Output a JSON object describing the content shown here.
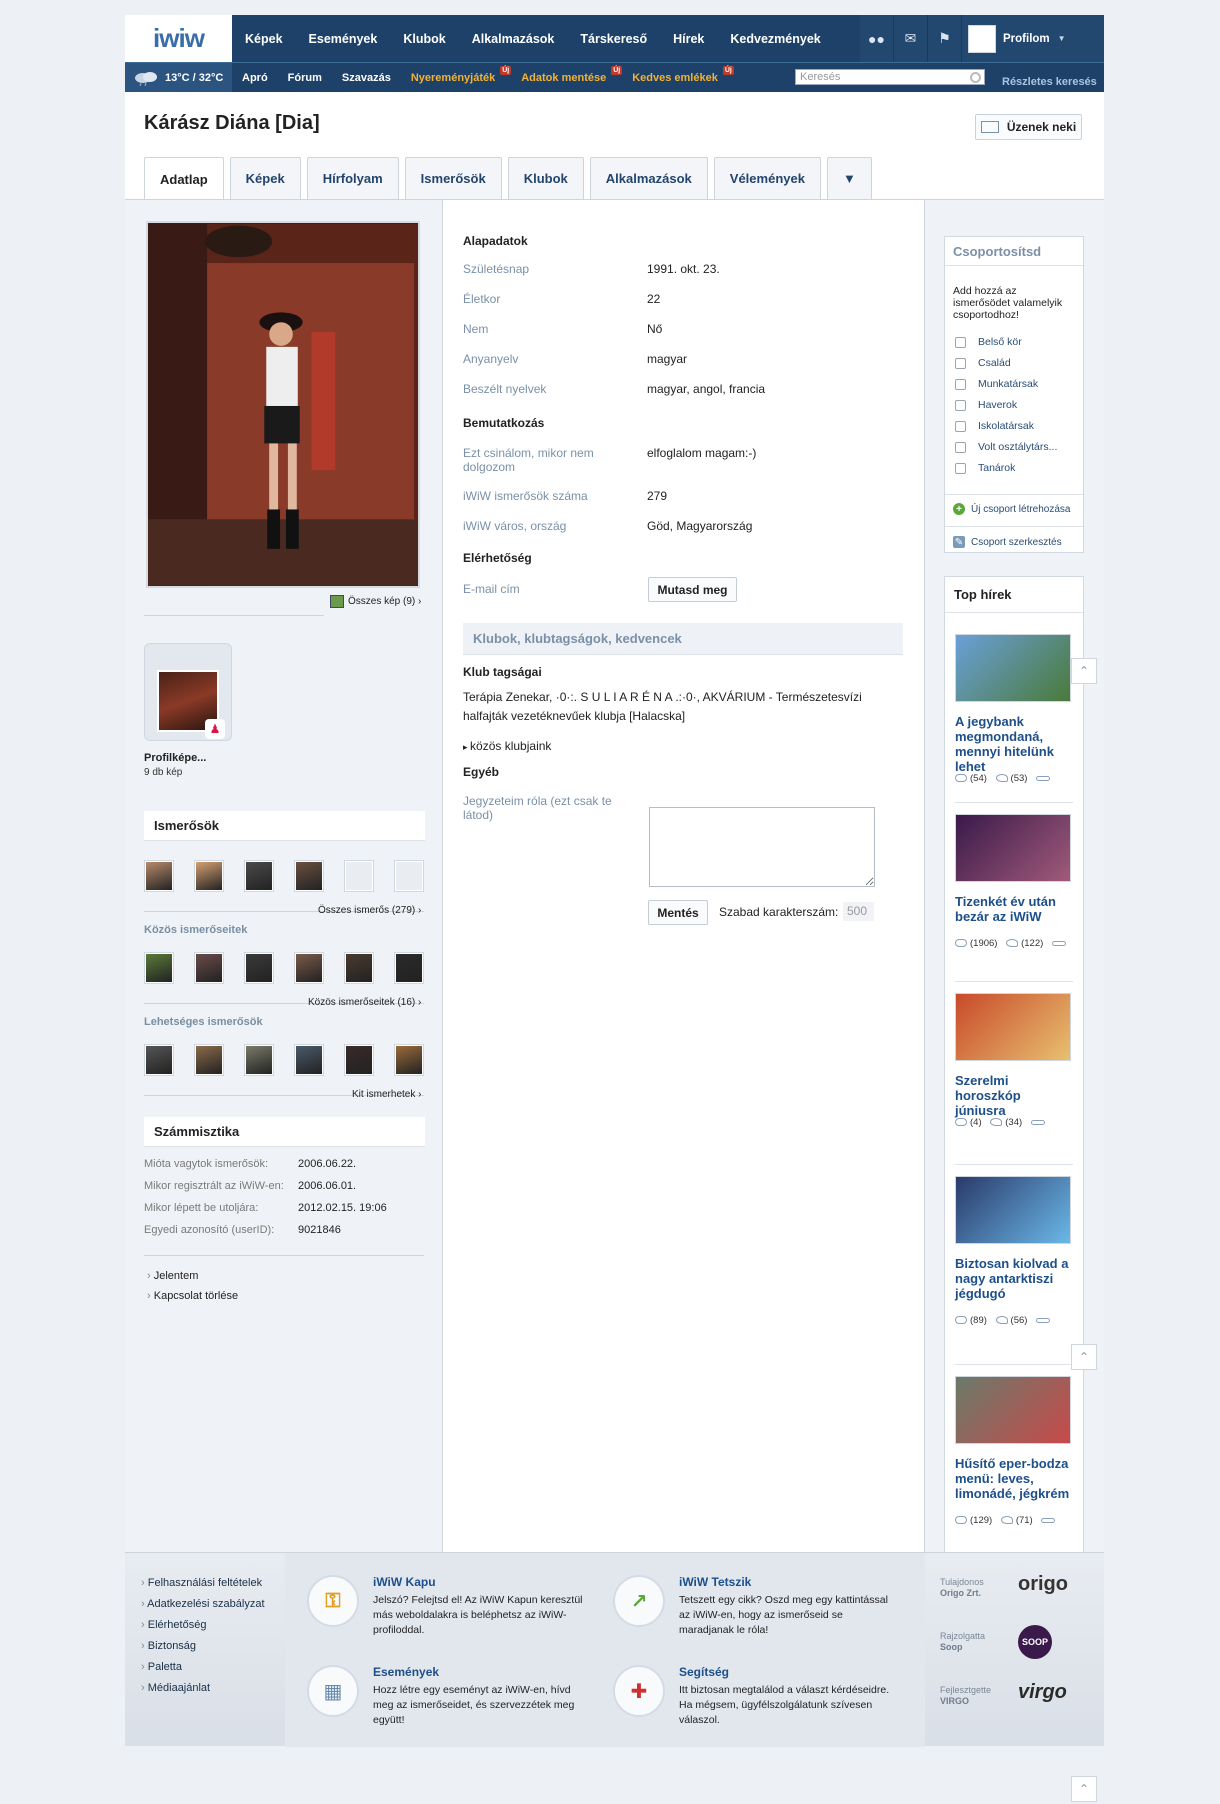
{
  "header": {
    "logo": "iwiw",
    "nav": [
      "Képek",
      "Események",
      "Klubok",
      "Alkalmazások",
      "Társkereső",
      "Hírek",
      "Kedvezmények"
    ],
    "weather": "13°C / 32°C",
    "subnav": [
      {
        "label": "Apró",
        "hot": false,
        "badge": ""
      },
      {
        "label": "Fórum",
        "hot": false,
        "badge": ""
      },
      {
        "label": "Szavazás",
        "hot": false,
        "badge": ""
      },
      {
        "label": "Nyereményjáték",
        "hot": true,
        "badge": "Új"
      },
      {
        "label": "Adatok mentése",
        "hot": true,
        "badge": "Új"
      },
      {
        "label": "Kedves emlékek",
        "hot": true,
        "badge": "Új"
      }
    ],
    "search_placeholder": "Keresés",
    "advanced_search": "Részletes keresés",
    "profile_label": "Profilom"
  },
  "profile": {
    "name": "Kárász Diána [Dia]",
    "message_button": "Üzenek neki",
    "tabs": [
      "Adatlap",
      "Képek",
      "Hírfolyam",
      "Ismerősök",
      "Klubok",
      "Alkalmazások",
      "Vélemények",
      "▼"
    ]
  },
  "left": {
    "all_photos": "Összes kép (9)",
    "album_title": "Profilképe...",
    "album_count": "9 db kép",
    "friends_title": "Ismerősök",
    "all_friends": "Összes ismerős (279)",
    "common_title": "Közös ismerőseitek",
    "common_link": "Közös ismerőseitek (16)",
    "possible_title": "Lehetséges ismerősök",
    "possible_link": "Kit ismerhetek",
    "stats_title": "Számmisztika",
    "stats": [
      {
        "k": "Mióta vagytok ismerősök:",
        "v": "2006.06.22."
      },
      {
        "k": "Mikor regisztrált az iWiW-en:",
        "v": "2006.06.01."
      },
      {
        "k": "Mikor lépett be utoljára:",
        "v": "2012.02.15. 19:06"
      },
      {
        "k": "Egyedi azonosító (userID):",
        "v": "9021846"
      }
    ],
    "actions": [
      "Jelentem",
      "Kapcsolat törlése"
    ],
    "friend_colors": [
      "#b88a6a",
      "#d3a070",
      "#4a4a4a",
      "#6b5040",
      "#e9edf2",
      "#e9edf2"
    ],
    "common_colors": [
      "#5a7a3a",
      "#6a4a4a",
      "#3a3a3a",
      "#7a5a4a",
      "#4a3a30",
      "#2a2a2a"
    ],
    "possible_colors": [
      "#555555",
      "#8a6a4a",
      "#7a7a6a",
      "#4a5a6a",
      "#3a2a2a",
      "#9a6a3a"
    ]
  },
  "main": {
    "basic_title": "Alapadatok",
    "basic": [
      {
        "k": "Születésnap",
        "v": "1991. okt. 23."
      },
      {
        "k": "Életkor",
        "v": "22"
      },
      {
        "k": "Nem",
        "v": "Nő"
      },
      {
        "k": "Anyanyelv",
        "v": "magyar"
      },
      {
        "k": "Beszélt nyelvek",
        "v": "magyar, angol, francia"
      }
    ],
    "intro_title": "Bemutatkozás",
    "intro": [
      {
        "k": "Ezt csinálom, mikor nem dolgozom",
        "v": "elfoglalom magam:-)"
      },
      {
        "k": "iWiW ismerősök száma",
        "v": "279"
      },
      {
        "k": "iWiW város, ország",
        "v": "Göd, Magyarország"
      }
    ],
    "contact_title": "Elérhetőség",
    "email_label": "E-mail cím",
    "show_button": "Mutasd meg",
    "clubs_bar": "Klubok, klubtagságok, kedvencek",
    "club_membership_title": "Klub tagságai",
    "club_text": "Terápia Zenekar, ·0·:. S U L I A R É N A .:·0·, AKVÁRIUM - Természetesvízi halfajták vezetéknevűek klubja [Halacska]",
    "common_clubs": "közös klubjaink",
    "other_title": "Egyéb",
    "notes_label": "Jegyzeteim róla (ezt csak te látod)",
    "save_button": "Mentés",
    "chars_label": "Szabad karakterszám:",
    "chars_left": "500"
  },
  "right": {
    "group_title": "Csoportosítsd",
    "group_intro": "Add hozzá az ismerősödet valamelyik csoportodhoz!",
    "groups": [
      "Belső kör",
      "Család",
      "Munkatársak",
      "Haverok",
      "Iskolatársak",
      "Volt osztálytárs...",
      "Tanárok"
    ],
    "new_group": "Új csoport létrehozása",
    "edit_group": "Csoport szerkesztés",
    "news_title": "Top hírek",
    "news": [
      {
        "title": "A jegybank megmondaná, mennyi hitelünk lehet",
        "comments": "(54)",
        "likes": "(53)",
        "colors": [
          "#6aa0d8",
          "#4a7a3a"
        ]
      },
      {
        "title": "Tizenkét év után bezár az iWiW",
        "comments": "(1906)",
        "likes": "(122)",
        "colors": [
          "#3a1a4a",
          "#a05a7a"
        ]
      },
      {
        "title": "Szerelmi horoszkóp júniusra",
        "comments": "(4)",
        "likes": "(34)",
        "colors": [
          "#c84a2a",
          "#e8c070"
        ]
      },
      {
        "title": "Biztosan kiolvad a nagy antarktiszi jégdugó",
        "comments": "(89)",
        "likes": "(56)",
        "colors": [
          "#2a3a6a",
          "#6ab8e8"
        ]
      },
      {
        "title": "Hűsítő eper-bodza menü: leves, limonádé, jégkrém",
        "comments": "(129)",
        "likes": "(71)",
        "colors": [
          "#6a7a6a",
          "#c84a4a"
        ]
      }
    ]
  },
  "footer": {
    "links": [
      "Felhasználási feltételek",
      "Adatkezelési szabályzat",
      "Elérhetőség",
      "Biztonság",
      "Paletta",
      "Médiaajánlat"
    ],
    "promos": [
      {
        "title": "iWiW Kapu",
        "text": "Jelszó? Felejtsd el! Az iWiW Kapun keresztül más weboldalakra is beléphetsz az iWiW-profiloddal."
      },
      {
        "title": "iWiW Tetszik",
        "text": "Tetszett egy cikk? Oszd meg egy kattintással az iWiW-en, hogy az ismerőseid se maradjanak le róla!"
      },
      {
        "title": "Események",
        "text": "Hozz létre egy eseményt az iWiW-en, hívd meg az ismerőseidet, és szervezzétek meg együtt!"
      },
      {
        "title": "Segítség",
        "text": "Itt biztosan megtalálod a választ kérdéseidre. Ha mégsem, ügyfélszolgálatunk szívesen válaszol."
      }
    ],
    "credits": [
      {
        "label": "Tulajdonos",
        "name": "Origo Zrt.",
        "logo": "origo"
      },
      {
        "label": "Rajzolgatta",
        "name": "Soop",
        "logo": "SOOP"
      },
      {
        "label": "Fejlesztgette",
        "name": "VIRGO",
        "logo": "virgo"
      }
    ]
  }
}
